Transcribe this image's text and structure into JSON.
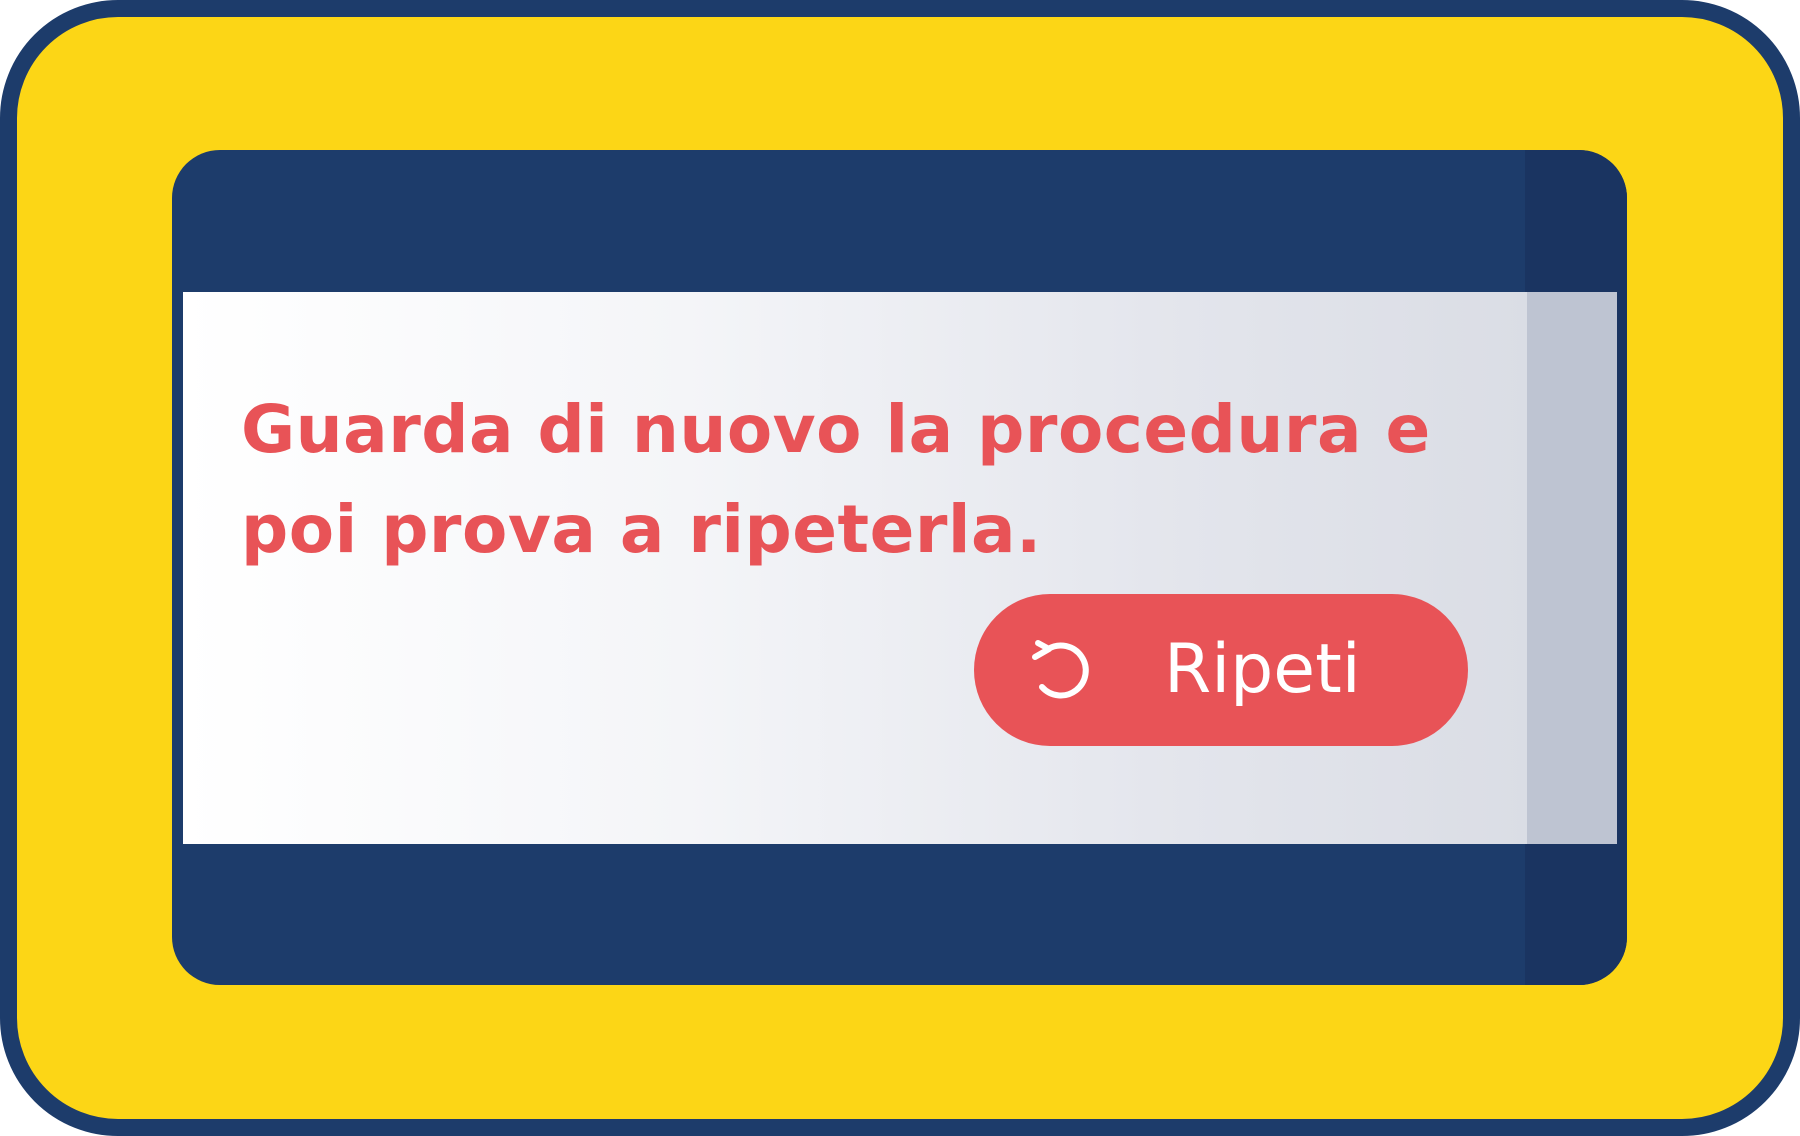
{
  "message": {
    "text": "Guarda di nuovo la procedura e poi prova a ripeterla."
  },
  "retry_button": {
    "label": "Ripeti",
    "icon": "retry-icon"
  },
  "colors": {
    "frame_fill": "#FCD616",
    "frame_border": "#1D3C6B",
    "panel": "#1D3C6B",
    "accent": "#E85357",
    "button_text": "#FFFFFF"
  }
}
